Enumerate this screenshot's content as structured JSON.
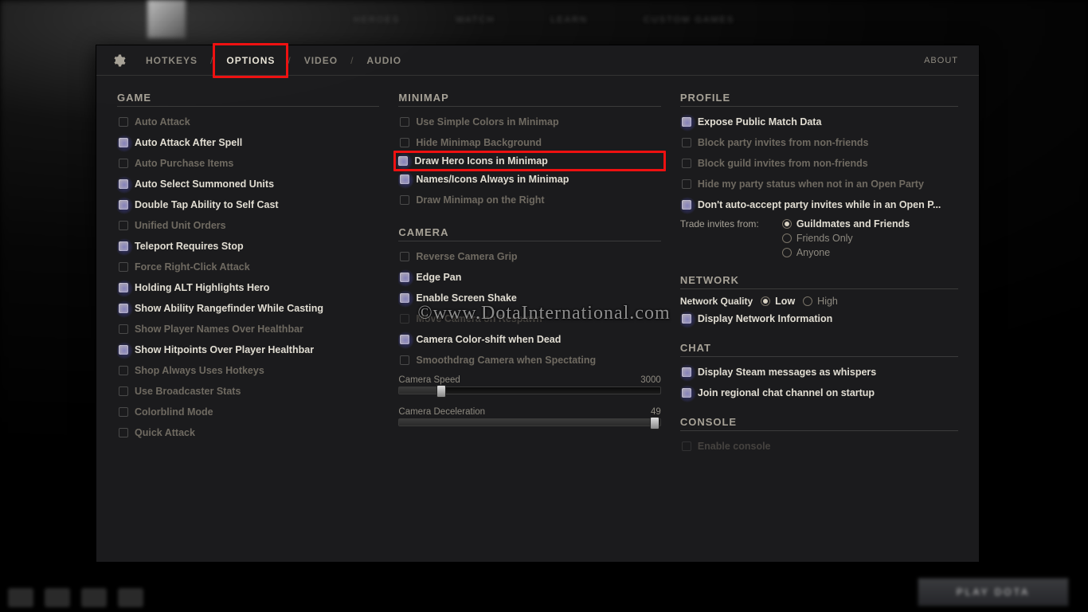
{
  "topnav_blur": [
    "HEROES",
    "WATCH",
    "LEARN",
    "CUSTOM GAMES"
  ],
  "tabs": {
    "hotkeys": "HOTKEYS",
    "options": "OPTIONS",
    "video": "VIDEO",
    "audio": "AUDIO",
    "about": "ABOUT"
  },
  "sections": {
    "game": "GAME",
    "minimap": "MINIMAP",
    "camera": "CAMERA",
    "profile": "PROFILE",
    "network": "NETWORK",
    "chat": "CHAT",
    "console": "CONSOLE"
  },
  "game": {
    "auto_attack": "Auto Attack",
    "auto_attack_after_spell": "Auto Attack After Spell",
    "auto_purchase_items": "Auto Purchase Items",
    "auto_select_summoned": "Auto Select Summoned Units",
    "double_tap_self_cast": "Double Tap Ability to Self Cast",
    "unified_unit_orders": "Unified Unit Orders",
    "teleport_requires_stop": "Teleport Requires Stop",
    "force_right_click_attack": "Force Right-Click Attack",
    "holding_alt_highlights_hero": "Holding ALT Highlights Hero",
    "show_ability_rangefinder": "Show Ability Rangefinder While Casting",
    "show_player_names": "Show Player Names Over Healthbar",
    "show_hitpoints": "Show Hitpoints Over Player Healthbar",
    "shop_hotkeys": "Shop Always Uses Hotkeys",
    "use_broadcaster_stats": "Use Broadcaster Stats",
    "colorblind_mode": "Colorblind Mode",
    "quick_attack": "Quick Attack"
  },
  "minimap": {
    "simple_colors": "Use Simple Colors in Minimap",
    "hide_background": "Hide Minimap Background",
    "draw_hero_icons": "Draw Hero Icons in Minimap",
    "names_icons_always": "Names/Icons Always in Minimap",
    "draw_on_right": "Draw Minimap on the Right"
  },
  "camera": {
    "reverse_grip": "Reverse Camera Grip",
    "edge_pan": "Edge Pan",
    "enable_screen_shake": "Enable Screen Shake",
    "move_on_respawn": "Move Camera on Respawn",
    "color_shift_dead": "Camera Color-shift when Dead",
    "smoothdrag_spectating": "Smoothdrag Camera when Spectating",
    "speed_label": "Camera Speed",
    "speed_value": "3000",
    "decel_label": "Camera Deceleration",
    "decel_value": "49"
  },
  "profile": {
    "expose_public": "Expose Public Match Data",
    "block_party_nonfriends": "Block party invites from non-friends",
    "block_guild_nonfriends": "Block guild invites from non-friends",
    "hide_party_status": "Hide my party status when not in an Open Party",
    "dont_autoaccept_open": "Don't auto-accept party invites while in an Open P...",
    "trade_from_label": "Trade invites from:",
    "trade_guildmates": "Guildmates and Friends",
    "trade_friends_only": "Friends Only",
    "trade_anyone": "Anyone"
  },
  "network": {
    "quality_label": "Network Quality",
    "low": "Low",
    "high": "High",
    "display_info": "Display Network Information"
  },
  "chat": {
    "display_whispers": "Display Steam messages as whispers",
    "join_regional": "Join regional chat channel on startup"
  },
  "console": {
    "enable": "Enable console"
  },
  "watermark": "©www.DotaInternational.com",
  "play_button": "PLAY DOTA"
}
